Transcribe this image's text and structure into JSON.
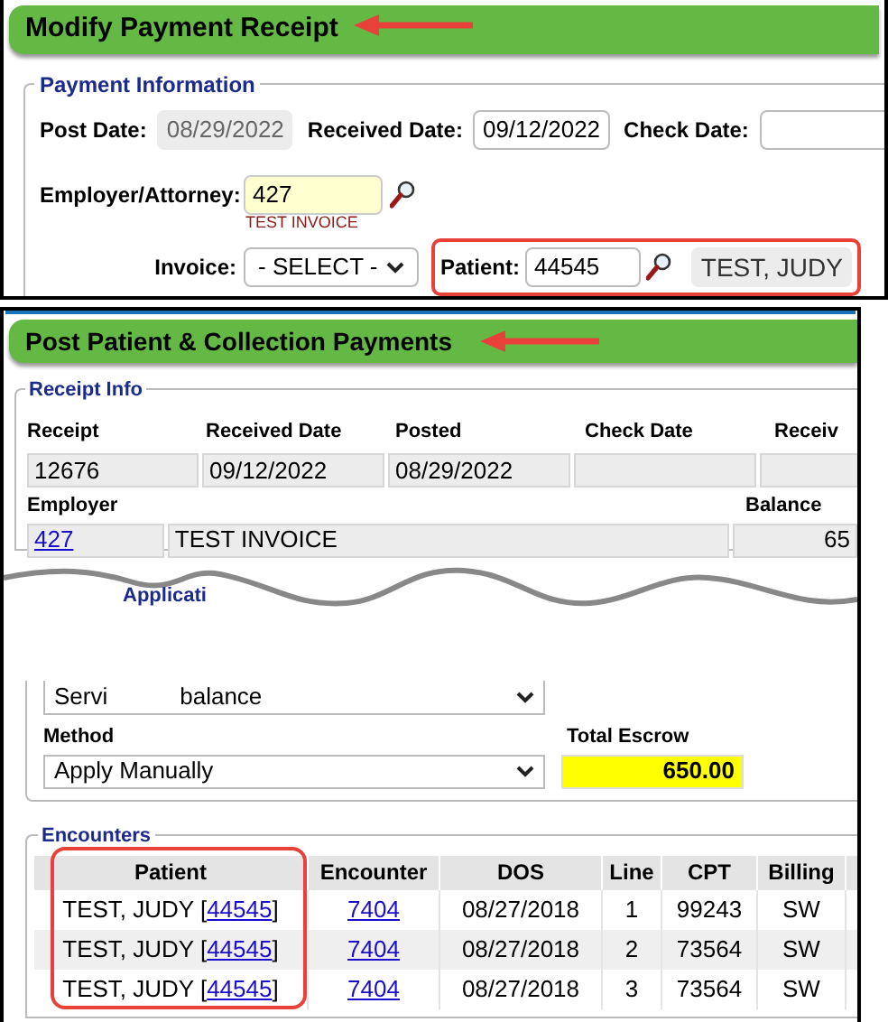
{
  "modify_receipt": {
    "title": "Modify Payment Receipt",
    "payment_information": {
      "legend": "Payment Information",
      "post_date": {
        "label": "Post Date:",
        "value": "08/29/2022",
        "disabled": true
      },
      "received_date": {
        "label": "Received Date:",
        "value": "09/12/2022"
      },
      "check_date": {
        "label": "Check Date:"
      },
      "employer": {
        "label": "Employer/Attorney:",
        "value": "427",
        "name": "TEST INVOICE"
      },
      "invoice": {
        "label": "Invoice:",
        "value": "- SELECT -"
      },
      "patient": {
        "label": "Patient:",
        "value": "44545",
        "name": "TEST, JUDY"
      }
    }
  },
  "post_payments": {
    "title": "Post Patient & Collection Payments",
    "receipt_info": {
      "legend": "Receipt Info",
      "columns": [
        "Receipt",
        "Received Date",
        "Posted",
        "Check Date",
        "Receiv"
      ],
      "values": [
        "12676",
        "09/12/2022",
        "08/29/2022"
      ],
      "employer_label": "Employer",
      "balance_label": "Balance",
      "employer_id": "427",
      "employer_name": "TEST INVOICE",
      "balance": "65"
    },
    "application": {
      "legend": "Applicati",
      "select_fragments": [
        "Servi",
        "balance"
      ],
      "method": {
        "label": "Method",
        "value": "Apply Manually"
      },
      "total_escrow": {
        "label": "Total Escrow",
        "value": "650.00"
      }
    },
    "encounters": {
      "legend": "Encounters",
      "columns": [
        "Patient",
        "Encounter",
        "DOS",
        "Line",
        "CPT",
        "Billing"
      ],
      "rows": [
        {
          "patient": "TEST, JUDY [",
          "patient_id": "44545",
          "close": "]",
          "encounter": "7404",
          "dos": "08/27/2018",
          "line": "1",
          "cpt": "99243",
          "billing": "SW"
        },
        {
          "patient": "TEST, JUDY [",
          "patient_id": "44545",
          "close": "]",
          "encounter": "7404",
          "dos": "08/27/2018",
          "line": "2",
          "cpt": "73564",
          "billing": "SW"
        },
        {
          "patient": "TEST, JUDY [",
          "patient_id": "44545",
          "close": "]",
          "encounter": "7404",
          "dos": "08/27/2018",
          "line": "3",
          "cpt": "73564",
          "billing": "SW"
        }
      ]
    }
  }
}
